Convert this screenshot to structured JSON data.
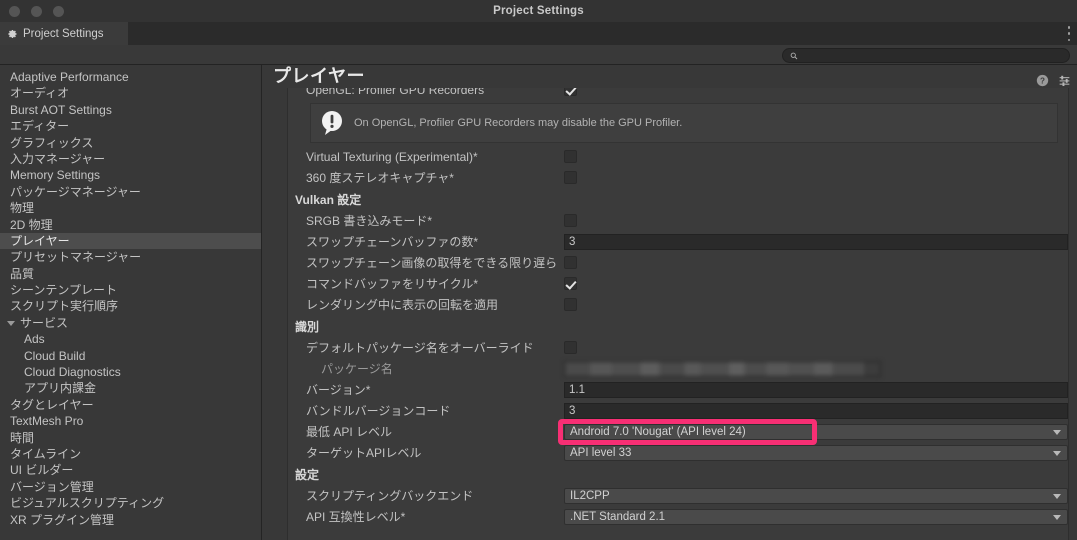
{
  "window": {
    "title": "Project Settings",
    "dots": 3
  },
  "tab": {
    "label": "Project Settings",
    "icon": "gear-icon",
    "menu_icon": "kebab-menu-icon"
  },
  "search": {
    "value": "",
    "placeholder": "",
    "icon": "search-icon"
  },
  "sidebar": {
    "items": [
      {
        "label": "Adaptive Performance",
        "selected": false,
        "level": 0
      },
      {
        "label": "オーディオ",
        "selected": false,
        "level": 0
      },
      {
        "label": "Burst AOT Settings",
        "selected": false,
        "level": 0
      },
      {
        "label": "エディター",
        "selected": false,
        "level": 0
      },
      {
        "label": "グラフィックス",
        "selected": false,
        "level": 0
      },
      {
        "label": "入力マネージャー",
        "selected": false,
        "level": 0
      },
      {
        "label": "Memory Settings",
        "selected": false,
        "level": 0
      },
      {
        "label": "パッケージマネージャー",
        "selected": false,
        "level": 0
      },
      {
        "label": "物理",
        "selected": false,
        "level": 0
      },
      {
        "label": "2D 物理",
        "selected": false,
        "level": 0
      },
      {
        "label": "プレイヤー",
        "selected": true,
        "level": 0
      },
      {
        "label": "プリセットマネージャー",
        "selected": false,
        "level": 0
      },
      {
        "label": "品質",
        "selected": false,
        "level": 0
      },
      {
        "label": "シーンテンプレート",
        "selected": false,
        "level": 0
      },
      {
        "label": "スクリプト実行順序",
        "selected": false,
        "level": 0
      },
      {
        "label": "サービス",
        "selected": false,
        "level": 0,
        "expanded": true
      },
      {
        "label": "Ads",
        "selected": false,
        "level": 1
      },
      {
        "label": "Cloud Build",
        "selected": false,
        "level": 1
      },
      {
        "label": "Cloud Diagnostics",
        "selected": false,
        "level": 1
      },
      {
        "label": "アプリ内課金",
        "selected": false,
        "level": 1
      },
      {
        "label": "タグとレイヤー",
        "selected": false,
        "level": 0
      },
      {
        "label": "TextMesh Pro",
        "selected": false,
        "level": 0
      },
      {
        "label": "時間",
        "selected": false,
        "level": 0
      },
      {
        "label": "タイムライン",
        "selected": false,
        "level": 0
      },
      {
        "label": "UI ビルダー",
        "selected": false,
        "level": 0
      },
      {
        "label": "バージョン管理",
        "selected": false,
        "level": 0
      },
      {
        "label": "ビジュアルスクリプティング",
        "selected": false,
        "level": 0
      },
      {
        "label": "XR プラグイン管理",
        "selected": false,
        "level": 0
      }
    ]
  },
  "page": {
    "title": "プレイヤー",
    "help_icon": "help-icon",
    "preset_icon": "preset-settings-icon"
  },
  "settings": {
    "clipped_row_label": "",
    "rows": [
      {
        "id": "opengl-profiler-gpu-recorders",
        "label": "OpenGL: Profiler GPU Recorders",
        "type": "checkbox",
        "value": true
      },
      {
        "id": "opengl-info",
        "type": "info",
        "text": "On OpenGL, Profiler GPU Recorders may disable the GPU Profiler.",
        "icon": "warning-icon"
      },
      {
        "id": "virtual-texturing",
        "label": "Virtual Texturing (Experimental)*",
        "type": "checkbox",
        "value": false
      },
      {
        "id": "stereo-360-capture",
        "label": "360 度ステレオキャプチャ*",
        "type": "checkbox",
        "value": false
      },
      {
        "id": "vulkan-settings",
        "label": "Vulkan 設定",
        "type": "section"
      },
      {
        "id": "srgb-write-mode",
        "label": "SRGB 書き込みモード*",
        "type": "checkbox",
        "value": false
      },
      {
        "id": "swapchain-buffer-count",
        "label": "スワップチェーンバッファの数*",
        "type": "text",
        "value": "3"
      },
      {
        "id": "acquire-swapchain-late",
        "label": "スワップチェーン画像の取得をできる限り遅ら",
        "type": "checkbox",
        "value": false
      },
      {
        "id": "recycle-command-buffers",
        "label": "コマンドバッファをリサイクル*",
        "type": "checkbox",
        "value": true
      },
      {
        "id": "apply-display-rotation",
        "label": "レンダリング中に表示の回転を適用",
        "type": "checkbox",
        "value": false
      },
      {
        "id": "identification",
        "label": "識別",
        "type": "section"
      },
      {
        "id": "override-default-package-name",
        "label": "デフォルトパッケージ名をオーバーライド",
        "type": "checkbox",
        "value": false
      },
      {
        "id": "package-name",
        "label": "パッケージ名",
        "type": "blurred",
        "value": ""
      },
      {
        "id": "version",
        "label": "バージョン*",
        "type": "text",
        "value": "1.1"
      },
      {
        "id": "bundle-version-code",
        "label": "バンドルバージョンコード",
        "type": "text",
        "value": "3"
      },
      {
        "id": "minimum-api-level",
        "label": "最低 API レベル",
        "type": "dropdown",
        "value": "Android 7.0 'Nougat' (API level 24)",
        "highlighted": true
      },
      {
        "id": "target-api-level",
        "label": "ターゲットAPIレベル",
        "type": "dropdown",
        "value": "API level 33"
      },
      {
        "id": "configuration",
        "label": "設定",
        "type": "section"
      },
      {
        "id": "scripting-backend",
        "label": "スクリプティングバックエンド",
        "type": "dropdown",
        "value": "IL2CPP"
      },
      {
        "id": "api-compatibility-level",
        "label": "API 互換性レベル*",
        "type": "dropdown",
        "value": ".NET Standard 2.1"
      }
    ]
  },
  "annotation": {
    "color": "#f72f74",
    "target": "minimum-api-level"
  }
}
